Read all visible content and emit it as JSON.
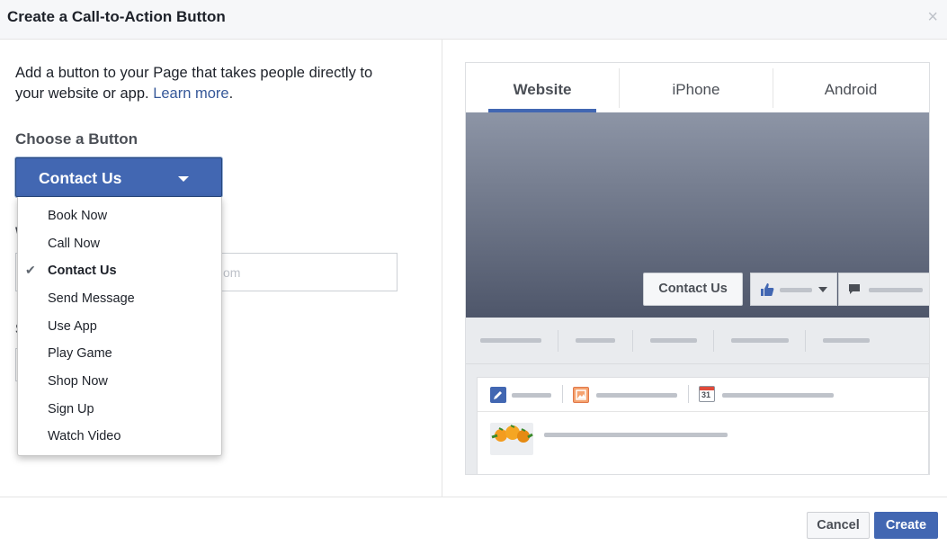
{
  "dialog": {
    "title": "Create a Call-to-Action Button",
    "close_glyph": "×"
  },
  "intro": {
    "text": "Add a button to your Page that takes people directly to your website or app.",
    "link": "Learn more",
    "trailing": "."
  },
  "choose": {
    "label": "Choose a Button",
    "selected": "Contact Us"
  },
  "background_fields": {
    "label_1_initial": "W",
    "input_placeholder_tail": "om",
    "label_2_initial": "S"
  },
  "dropdown": {
    "items": [
      {
        "label": "Book Now",
        "selected": false
      },
      {
        "label": "Call Now",
        "selected": false
      },
      {
        "label": "Contact Us",
        "selected": true
      },
      {
        "label": "Send Message",
        "selected": false
      },
      {
        "label": "Use App",
        "selected": false
      },
      {
        "label": "Play Game",
        "selected": false
      },
      {
        "label": "Shop Now",
        "selected": false
      },
      {
        "label": "Sign Up",
        "selected": false
      },
      {
        "label": "Watch Video",
        "selected": false
      }
    ],
    "check_glyph": "✔"
  },
  "preview": {
    "tabs": [
      {
        "label": "Website",
        "active": true
      },
      {
        "label": "iPhone",
        "active": false
      },
      {
        "label": "Android",
        "active": false
      }
    ],
    "cta_label": "Contact Us",
    "calendar_day": "31"
  },
  "footer": {
    "cancel_label": "Cancel",
    "create_label": "Create"
  },
  "colors": {
    "brand": "#4267b2",
    "link": "#365899"
  },
  "icons": [
    "close-icon",
    "caret-down-icon",
    "check-icon",
    "like-icon",
    "message-icon",
    "pencil-icon",
    "photo-icon",
    "calendar-icon",
    "oranges-icon"
  ]
}
